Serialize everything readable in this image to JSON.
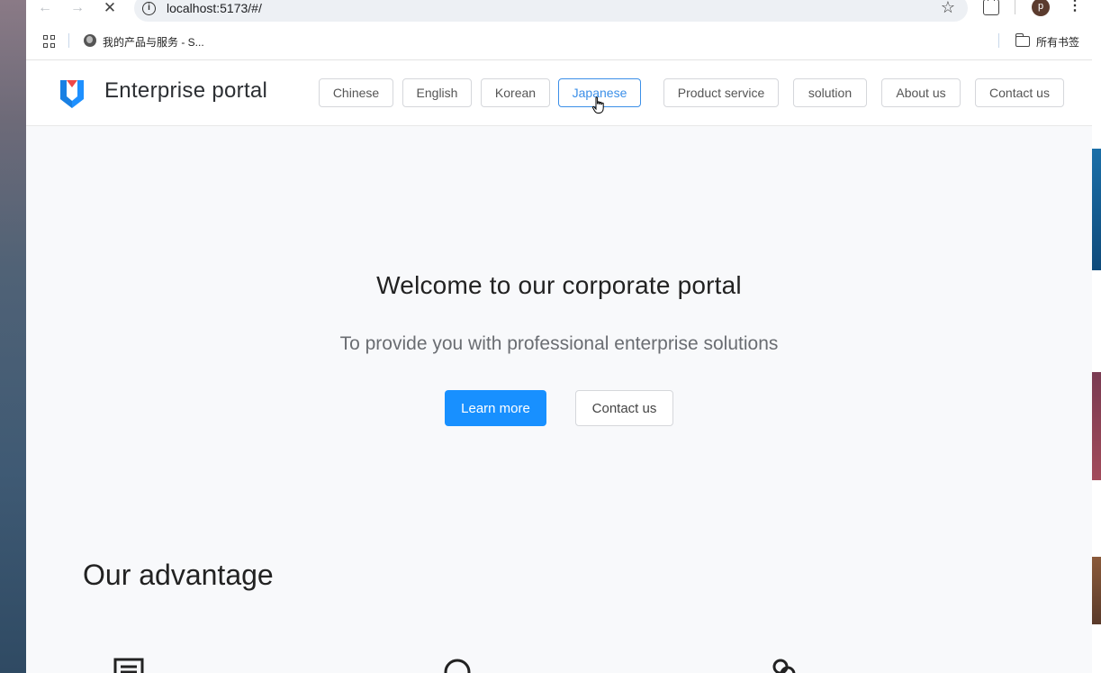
{
  "browser": {
    "url": "localhost:5173/#/",
    "profile_initial": "p",
    "bookmark_label": "我的产品与服务 - S...",
    "all_bookmarks_label": "所有书签"
  },
  "header": {
    "brand": "Enterprise portal",
    "language_buttons": [
      "Chinese",
      "English",
      "Korean",
      "Japanese"
    ],
    "active_language": "Japanese",
    "nav_buttons": [
      "Product service",
      "solution",
      "About us",
      "Contact us"
    ]
  },
  "hero": {
    "title": "Welcome to our corporate portal",
    "subtitle": "To provide you with professional enterprise solutions",
    "primary_button": "Learn more",
    "secondary_button": "Contact us"
  },
  "advantages": {
    "title": "Our advantage",
    "icons": [
      "document-icon",
      "search-icon",
      "link-icon"
    ]
  },
  "colors": {
    "primary": "#1890ff",
    "active_border": "#3b8fe8",
    "logo_blue": "#1e90ff",
    "logo_red": "#f04848"
  }
}
